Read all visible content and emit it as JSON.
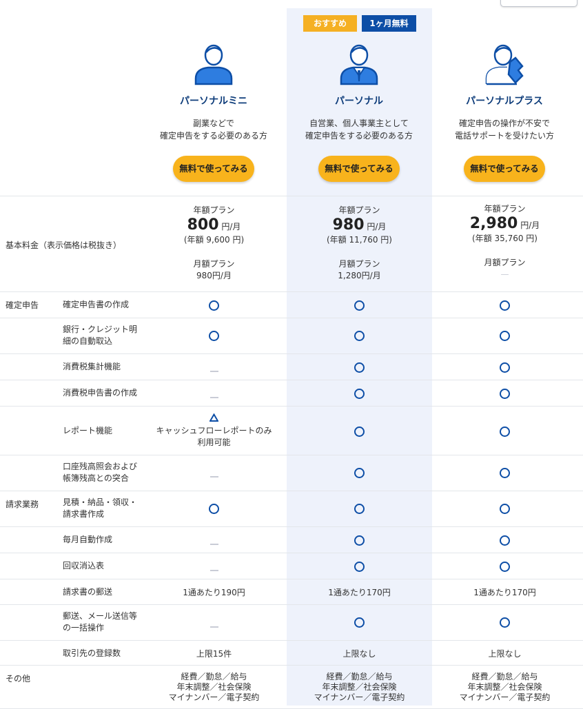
{
  "badges": {
    "recommended": "おすすめ",
    "free": "1ヶ月無料"
  },
  "colors": {
    "primary": "#0d4ea6",
    "accent": "#f8b31c",
    "highlight_bg": "#eef2fb"
  },
  "plans": [
    {
      "name": "パーソナルミニ",
      "icon": "person-icon",
      "desc1": "副業などで",
      "desc2": "確定申告をする必要のある方",
      "cta": "無料で使ってみる"
    },
    {
      "name": "パーソナル",
      "icon": "businessperson-icon",
      "desc1": "自営業、個人事業主として",
      "desc2": "確定申告をする必要のある方",
      "cta": "無料で使ってみる"
    },
    {
      "name": "パーソナルプラス",
      "icon": "phone-support-icon",
      "desc1": "確定申告の操作が不安で",
      "desc2": "電話サポートを受けたい方",
      "cta": "無料で使ってみる"
    }
  ],
  "pricing": {
    "label": "基本料金（表示価格は税抜き）",
    "annual_label": "年額プラン",
    "monthly_label": "月額プラン",
    "unit": "円/月",
    "plans": [
      {
        "price": "800",
        "annual_total": "(年額 9,600 円)",
        "monthly": "980円/月"
      },
      {
        "price": "980",
        "annual_total": "(年額 11,760 円)",
        "monthly": "1,280円/月"
      },
      {
        "price": "2,980",
        "annual_total": "(年額 35,760 円)",
        "monthly": "—"
      }
    ]
  },
  "categories": {
    "tax": "確定申告",
    "invoice": "請求業務",
    "other": "その他"
  },
  "features": [
    {
      "label1": "確定申告書の作成",
      "label2": "",
      "values": [
        "o",
        "o",
        "o"
      ]
    },
    {
      "label1": "銀行・クレジット明",
      "label2": "細の自動取込",
      "values": [
        "o",
        "o",
        "o"
      ]
    },
    {
      "label1": "消費税集計機能",
      "label2": "",
      "values": [
        "-",
        "o",
        "o"
      ]
    },
    {
      "label1": "消費税申告書の作成",
      "label2": "",
      "values": [
        "-",
        "o",
        "o"
      ]
    },
    {
      "label1": "レポート機能",
      "label2": "",
      "values": [
        "tri",
        "o",
        "o"
      ],
      "note1": "キャッシュフローレポートのみ",
      "note2": "利用可能"
    },
    {
      "label1": "口座残高照会および",
      "label2": "帳簿残高との突合",
      "values": [
        "-",
        "o",
        "o"
      ]
    },
    {
      "label1": "見積・納品・領収・",
      "label2": "請求書作成",
      "values": [
        "o",
        "o",
        "o"
      ]
    },
    {
      "label1": "毎月自動作成",
      "label2": "",
      "values": [
        "-",
        "o",
        "o"
      ]
    },
    {
      "label1": "回収消込表",
      "label2": "",
      "values": [
        "-",
        "o",
        "o"
      ]
    },
    {
      "label1": "請求書の郵送",
      "label2": "",
      "texts": [
        "1通あたり190円",
        "1通あたり170円",
        "1通あたり170円"
      ]
    },
    {
      "label1": "郵送、メール送信等",
      "label2": "の一括操作",
      "values": [
        "-",
        "o",
        "o"
      ]
    },
    {
      "label1": "取引先の登録数",
      "label2": "",
      "texts": [
        "上限15件",
        "上限なし",
        "上限なし"
      ]
    }
  ],
  "other": {
    "line1": "経費／勤怠／給与",
    "line2": "年末調整／社会保険",
    "line3": "マイナンバー／電子契約"
  }
}
